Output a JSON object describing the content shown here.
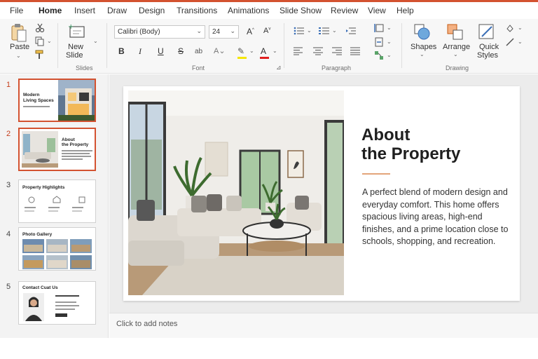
{
  "menu": {
    "tabs": [
      {
        "label": "File"
      },
      {
        "label": "Home"
      },
      {
        "label": "Insert"
      },
      {
        "label": "Draw"
      },
      {
        "label": "Design"
      },
      {
        "label": "Transitions"
      },
      {
        "label": "Animations"
      },
      {
        "label": "Slide Show"
      },
      {
        "label": "Review"
      },
      {
        "label": "View"
      },
      {
        "label": "Help"
      }
    ],
    "active": "Home"
  },
  "ribbon": {
    "clipboard": {
      "paste_label": "Paste"
    },
    "slides": {
      "new_slide_label_1": "New",
      "new_slide_label_2": "Slide",
      "group_label": "Slides"
    },
    "font": {
      "family": "Calibri (Body)",
      "size": "24",
      "group_label": "Font"
    },
    "paragraph": {
      "group_label": "Paragraph"
    },
    "drawing": {
      "shapes_label": "Shapes",
      "arrange_label": "Arrange",
      "quick_styles_label_1": "Quick",
      "quick_styles_label_2": "Styles",
      "group_label": "Drawing"
    }
  },
  "thumbnails": [
    {
      "number": "1",
      "title_1": "Modern",
      "title_2": "Living Spaces"
    },
    {
      "number": "2",
      "title_1": "About",
      "title_2": "the Property"
    },
    {
      "number": "3",
      "title_1": "Property Highlights"
    },
    {
      "number": "4",
      "title_1": "Photo Gallery"
    },
    {
      "number": "5",
      "title_1": "Contact Cuat Us"
    }
  ],
  "slide": {
    "title_line1": "About",
    "title_line2": "the Property",
    "body": "A perfect blend of modern design and everyday comfort. This home offers spacious living areas, high-end finishes, and a prime location close to schools, shopping, and recreation."
  },
  "notes": {
    "placeholder": "Click to add notes"
  },
  "colors": {
    "accent": "#d35230",
    "selected_border": "#d35230",
    "rule": "#e3a47a"
  }
}
